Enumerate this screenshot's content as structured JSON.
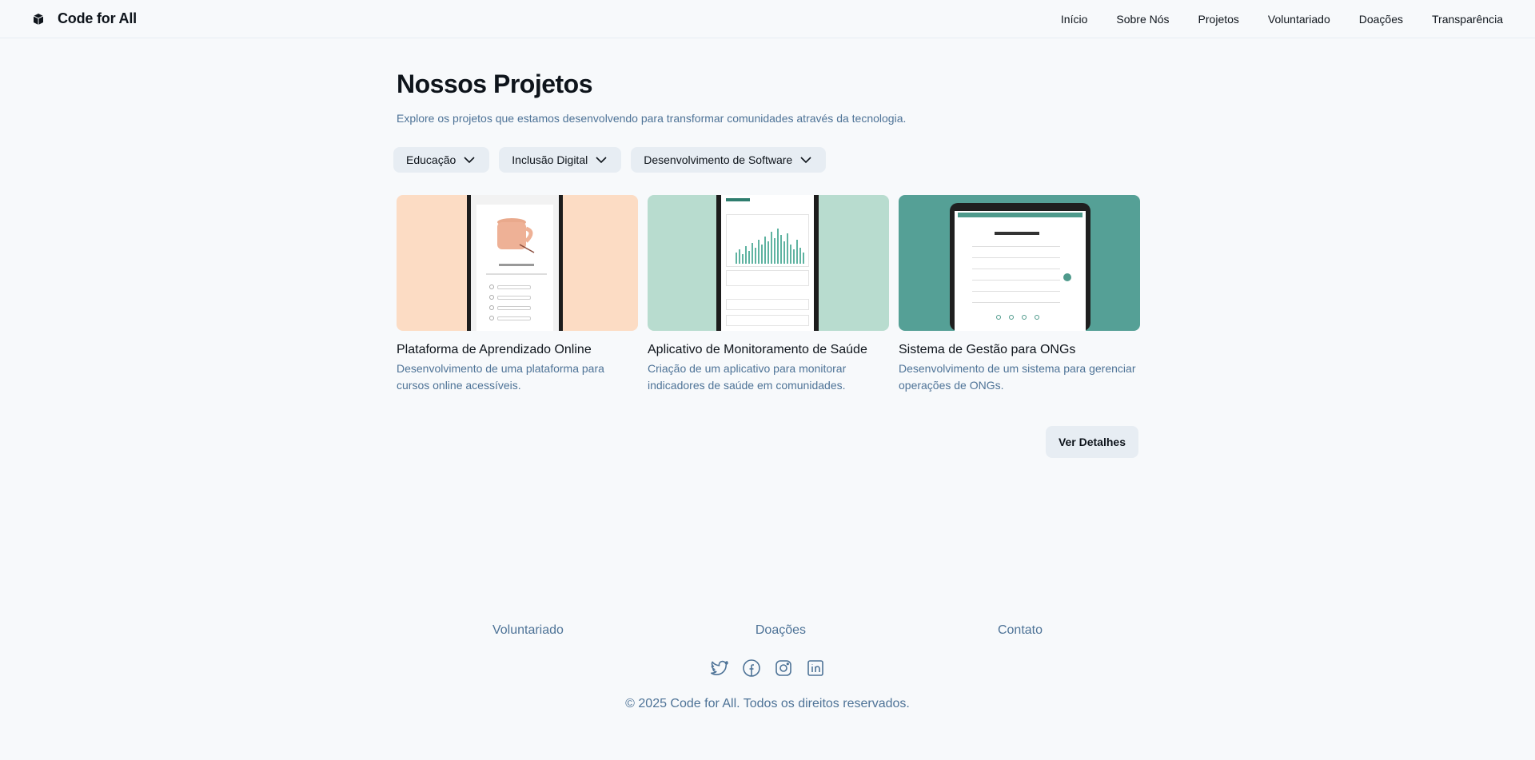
{
  "header": {
    "brand": "Code for All",
    "nav": [
      "Início",
      "Sobre Nós",
      "Projetos",
      "Voluntariado",
      "Doações",
      "Transparência"
    ]
  },
  "main": {
    "title": "Nossos Projetos",
    "subtitle": "Explore os projetos que estamos desenvolvendo para transformar comunidades através da tecnologia.",
    "filters": [
      "Educação",
      "Inclusão Digital",
      "Desenvolvimento de Software"
    ],
    "projects": [
      {
        "title": "Plataforma de Aprendizado Online",
        "description": "Desenvolvimento de uma plataforma para cursos online acessíveis.",
        "thumb_bg": "#fcdcc4"
      },
      {
        "title": "Aplicativo de Monitoramento de Saúde",
        "description": "Criação de um aplicativo para monitorar indicadores de saúde em comunidades.",
        "thumb_bg": "#b8dccf"
      },
      {
        "title": "Sistema de Gestão para ONGs",
        "description": "Desenvolvimento de um sistema para gerenciar operações de ONGs.",
        "thumb_bg": "#55a096"
      }
    ],
    "details_button": "Ver Detalhes"
  },
  "footer": {
    "links": [
      "Voluntariado",
      "Doações",
      "Contato"
    ],
    "socials": [
      "twitter-icon",
      "facebook-icon",
      "instagram-icon",
      "linkedin-icon"
    ],
    "copyright": "© 2025 Code for All. Todos os direitos reservados."
  },
  "colors": {
    "background": "#f7f9fb",
    "chip": "#e7edf3",
    "muted_text": "#4e7397",
    "text": "#0e141b"
  }
}
